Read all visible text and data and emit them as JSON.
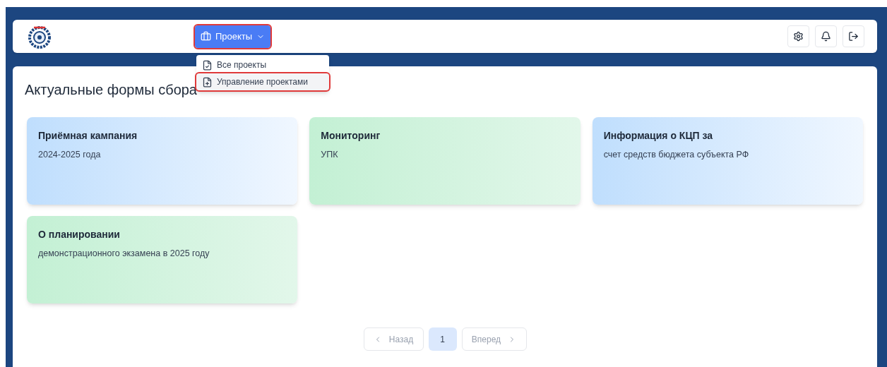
{
  "header": {
    "menu_button": {
      "label": "Проекты",
      "highlighted": true,
      "expanded": true
    },
    "menu_items": [
      {
        "label": "Все проекты",
        "kind": "list",
        "highlighted": false
      },
      {
        "label": "Управление проектами",
        "kind": "add",
        "highlighted": true
      }
    ]
  },
  "page": {
    "title": "Актуальные формы сбора",
    "cards": [
      {
        "title": "Приёмная кампания",
        "subtitle": "2024-2025 года",
        "kind": "blue"
      },
      {
        "title": "Мониторинг",
        "subtitle": "УПК",
        "kind": "green"
      },
      {
        "title": "Информация о КЦП за",
        "subtitle": "счет средств бюджета субъекта РФ",
        "kind": "blue"
      },
      {
        "title": "О планировании",
        "subtitle": "демонстрационного экзамена в 2025 году",
        "kind": "green"
      }
    ],
    "pagination": {
      "prev": {
        "label": "Назад",
        "disabled": true
      },
      "pages": [
        {
          "label": "1",
          "selected": true
        }
      ],
      "next": {
        "label": "Вперед",
        "disabled": true
      }
    }
  }
}
